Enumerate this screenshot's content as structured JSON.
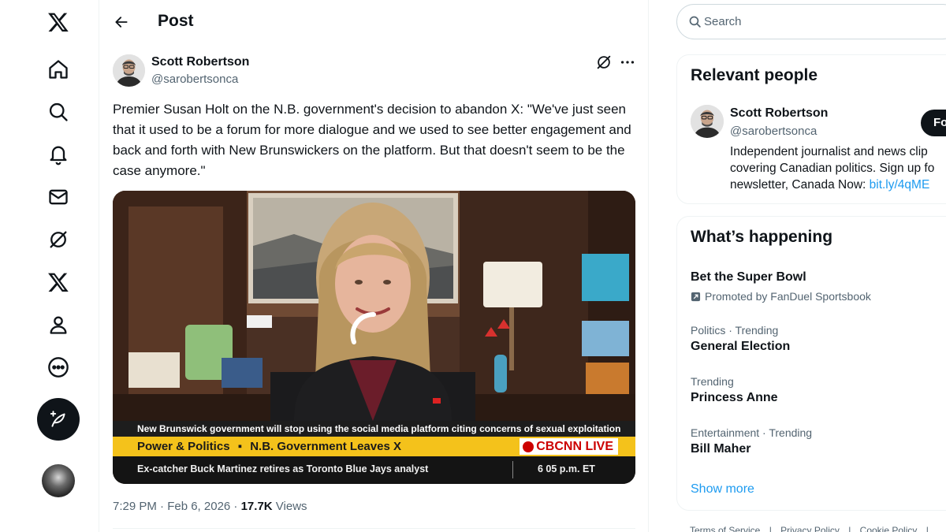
{
  "nav": {
    "items": [
      {
        "name": "x-logo-icon"
      },
      {
        "name": "home-icon"
      },
      {
        "name": "explore-icon"
      },
      {
        "name": "notifications-icon"
      },
      {
        "name": "messages-icon"
      },
      {
        "name": "grok-icon"
      },
      {
        "name": "premium-x-icon"
      },
      {
        "name": "profile-icon"
      },
      {
        "name": "more-icon"
      }
    ],
    "post_button_icon": "feather-plus-icon"
  },
  "header": {
    "title": "Post"
  },
  "post": {
    "author_name": "Scott Robertson",
    "author_handle": "@sarobertsonca",
    "text": "Premier Susan Holt on the N.B. government's decision to abandon X: \"We've just seen that it used to be a forum for more dialogue and we used to see better engagement and back and forth with New Brunswickers on the platform. But that doesn't seem to be the case anymore.\"",
    "media": {
      "headline": "New Brunswick government will stop using the social media platform citing concerns of sexual exploitation",
      "show": "Power & Politics",
      "bullet": "▪",
      "segment": "N.B. Government Leaves X",
      "network": "CBCNN LIVE",
      "ticker": "Ex-catcher Buck Martinez retires as Toronto Blue Jays analyst",
      "time": "6 05 p.m. ET"
    },
    "timestamp": "7:29 PM · Feb 6, 2026 · ",
    "views_count": "17.7K",
    "views_label": " Views"
  },
  "search": {
    "placeholder": "Search"
  },
  "relevant_people": {
    "title": "Relevant people",
    "person": {
      "name": "Scott Robertson",
      "handle": "@sarobertsonca",
      "follow_label": "Follow",
      "bio_line1": "Independent journalist and news clip",
      "bio_line2": "covering Canadian politics. Sign up fo",
      "bio_line3_text": "newsletter, Canada Now: ",
      "bio_link": "bit.ly/4qME"
    }
  },
  "whats_happening": {
    "title": "What’s happening",
    "trends": [
      {
        "label": "",
        "title": "Bet the Super Bowl",
        "promo": "Promoted by FanDuel Sportsbook"
      },
      {
        "label": "Politics · Trending",
        "title": "General Election"
      },
      {
        "label": "Trending",
        "title": "Princess Anne"
      },
      {
        "label": "Entertainment · Trending",
        "title": "Bill Maher"
      }
    ],
    "show_more": "Show more"
  },
  "footer": {
    "links": [
      "Terms of Service",
      "|",
      "Privacy Policy",
      "|",
      "Cookie Policy",
      "|"
    ]
  },
  "colors": {
    "accent": "#1d9bf0",
    "text": "#0f1419",
    "muted": "#536471",
    "chyron_yellow": "#f4c21b",
    "cbc_red": "#cc0000"
  }
}
